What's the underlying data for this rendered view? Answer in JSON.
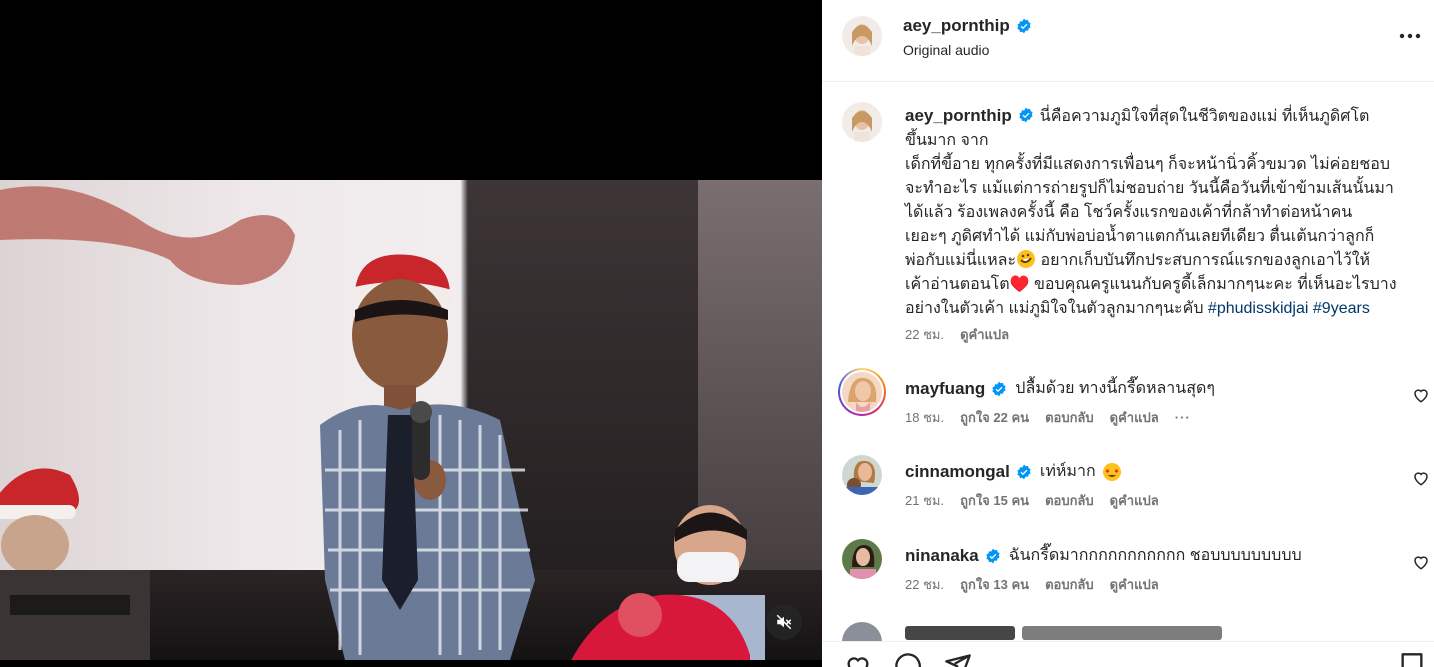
{
  "colors": {
    "accent": "#0095f6",
    "hashtag": "#00376b",
    "muted": "#737373",
    "text": "#262626",
    "verified": "#0095f6"
  },
  "video": {
    "mute_icon": "speaker-muted-icon"
  },
  "header": {
    "username": "aey_pornthip",
    "verified": true,
    "subtitle": "Original audio",
    "more_icon": "more-horizontal-icon"
  },
  "caption": {
    "username": "aey_pornthip",
    "lines": [
      "นี่คือความภูมิใจที่สุดในชีวิตของแม่ ที่เห็นภูดิศโต",
      "ขึ้นมาก จาก",
      "เด็กที่ขี้อาย ทุกครั้งที่มีแสดงการเพื่อนๆ ก็จะหน้านิ่วคิ้วขมวด ไม่ค่อยชอบ",
      "จะทำอะไร แม้แต่การถ่ายรูปก็ไม่ชอบถ่าย วันนี้คือวันที่เข้าข้ามเส้นนั้นมา",
      "ได้แล้ว ร้องเพลงครั้งนี้ คือ โชว์ครั้งแรกของเค้าที่กล้าทำต่อหน้าคน",
      "เยอะๆ ภูดิศทำได้ แม่กับพ่อบ่อน้ำตาแตกกันเลยทีเดียว ตื่นเต้นกว่าลูกก็",
      "พ่อกับแม่นี่แหละ",
      "อยากเก็บบันทึกประสบการณ์แรกของลูกเอาไว้ให้",
      "เค้าอ่านตอนโต♥️ ขอบคุณครูแนนกับครูดี้เล็กมากๆนะคะ ที่เห็นอะไรบาง",
      "อย่างในตัวเค้า แม่ภูมิใจในตัวลูกมากๆนะคับ"
    ],
    "hashtags": [
      "#phudisskidjai",
      "#9years"
    ],
    "time": "22 ชม.",
    "translate": "ดูคำแปล"
  },
  "comments": [
    {
      "username": "mayfuang",
      "text": "ปลื้มด้วย ทางนี้กรี๊ดหลานสุดๆ",
      "time": "18 ชม.",
      "likes": "ถูกใจ 22 คน",
      "reply": "ตอบกลับ",
      "translate": "ดูคำแปล",
      "more": "···"
    },
    {
      "username": "cinnamongal",
      "text": "เท่ห์มาก",
      "time": "21 ชม.",
      "likes": "ถูกใจ 15 คน",
      "reply": "ตอบกลับ",
      "translate": "ดูคำแปล"
    },
    {
      "username": "ninanaka",
      "text": "ฉันกรี๊ดมากกกกกกกกกกก ชอบบบบบบบบบ",
      "time": "22 ชม.",
      "likes": "ถูกใจ 13 คน",
      "reply": "ตอบกลับ",
      "translate": "ดูคำแปล"
    }
  ],
  "actions": {
    "like_icon": "heart-icon",
    "comment_icon": "comment-icon",
    "share_icon": "paper-plane-icon",
    "save_icon": "bookmark-icon"
  }
}
